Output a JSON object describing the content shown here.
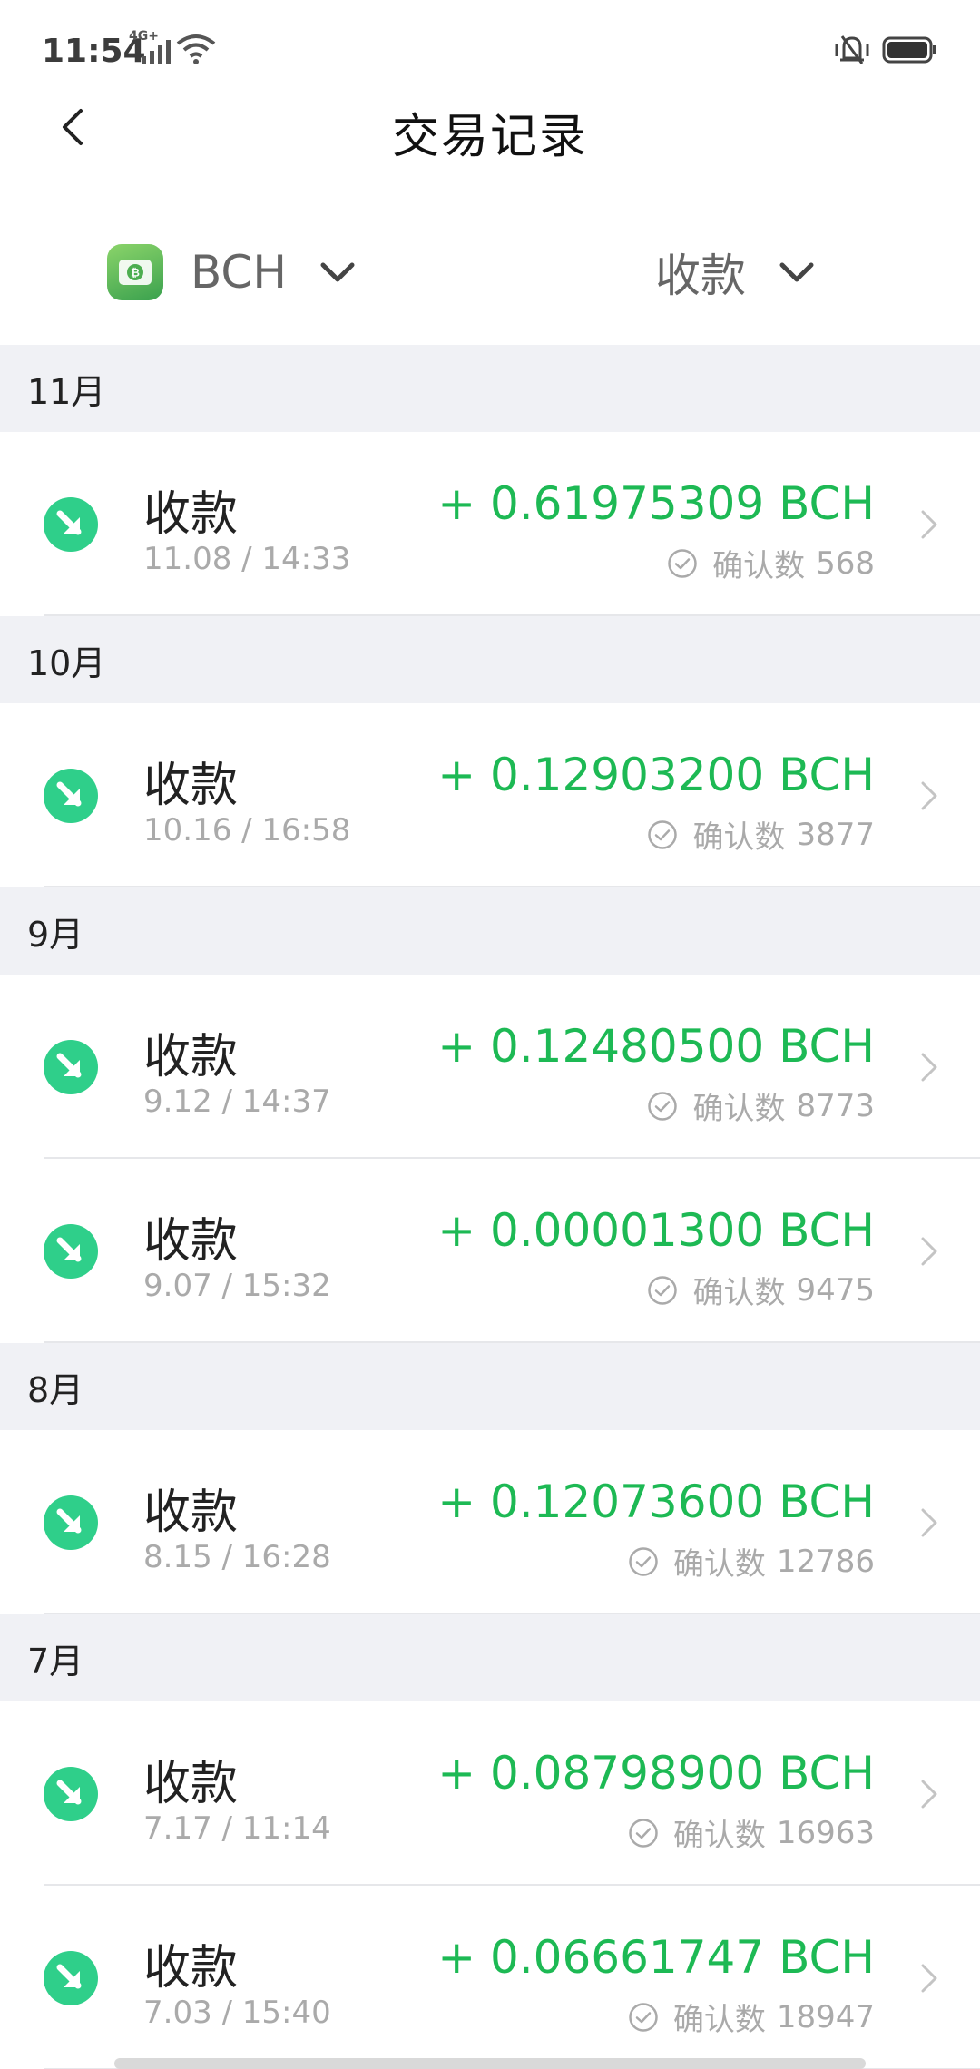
{
  "status_bar": {
    "time": "11:54",
    "network": "4G+"
  },
  "header": {
    "title": "交易记录"
  },
  "filters": {
    "coin": {
      "label": "BCH",
      "icon": "bch-coin-icon"
    },
    "type": {
      "label": "收款"
    }
  },
  "colors": {
    "accent_green": "#1db954",
    "icon_green": "#2fcf8a",
    "month_bg": "#f0f1f5",
    "muted_text": "#aaaaaa"
  },
  "months": [
    {
      "label": "11月",
      "transactions": [
        {
          "type": "收款",
          "date": "11.08 / 14:33",
          "amount": "+ 0.61975309 BCH",
          "confirm_label": "确认数",
          "confirmations": "568"
        }
      ]
    },
    {
      "label": "10月",
      "transactions": [
        {
          "type": "收款",
          "date": "10.16 / 16:58",
          "amount": "+ 0.12903200 BCH",
          "confirm_label": "确认数",
          "confirmations": "3877"
        }
      ]
    },
    {
      "label": "9月",
      "transactions": [
        {
          "type": "收款",
          "date": "9.12 / 14:37",
          "amount": "+ 0.12480500 BCH",
          "confirm_label": "确认数",
          "confirmations": "8773"
        },
        {
          "type": "收款",
          "date": "9.07 / 15:32",
          "amount": "+ 0.00001300 BCH",
          "confirm_label": "确认数",
          "confirmations": "9475"
        }
      ]
    },
    {
      "label": "8月",
      "transactions": [
        {
          "type": "收款",
          "date": "8.15 / 16:28",
          "amount": "+ 0.12073600 BCH",
          "confirm_label": "确认数",
          "confirmations": "12786"
        }
      ]
    },
    {
      "label": "7月",
      "transactions": [
        {
          "type": "收款",
          "date": "7.17 / 11:14",
          "amount": "+ 0.08798900 BCH",
          "confirm_label": "确认数",
          "confirmations": "16963"
        },
        {
          "type": "收款",
          "date": "7.03 / 15:40",
          "amount": "+ 0.06661747 BCH",
          "confirm_label": "确认数",
          "confirmations": "18947"
        }
      ]
    }
  ]
}
